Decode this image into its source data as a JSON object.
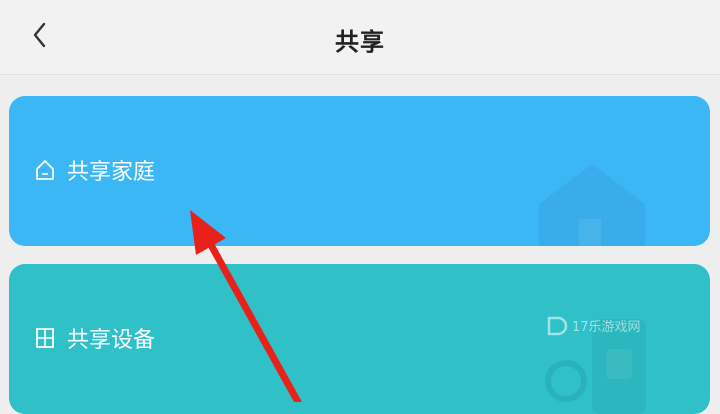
{
  "header": {
    "title": "共享",
    "back_icon": "chevron-left-icon"
  },
  "cards": [
    {
      "label": "共享家庭",
      "icon": "house-icon",
      "color": "#3bb7f6"
    },
    {
      "label": "共享设备",
      "icon": "device-grid-icon",
      "color": "#2fc0c8"
    }
  ],
  "watermark": {
    "text": "17乐游戏网"
  },
  "annotation": {
    "arrow_color": "#e8211b"
  }
}
